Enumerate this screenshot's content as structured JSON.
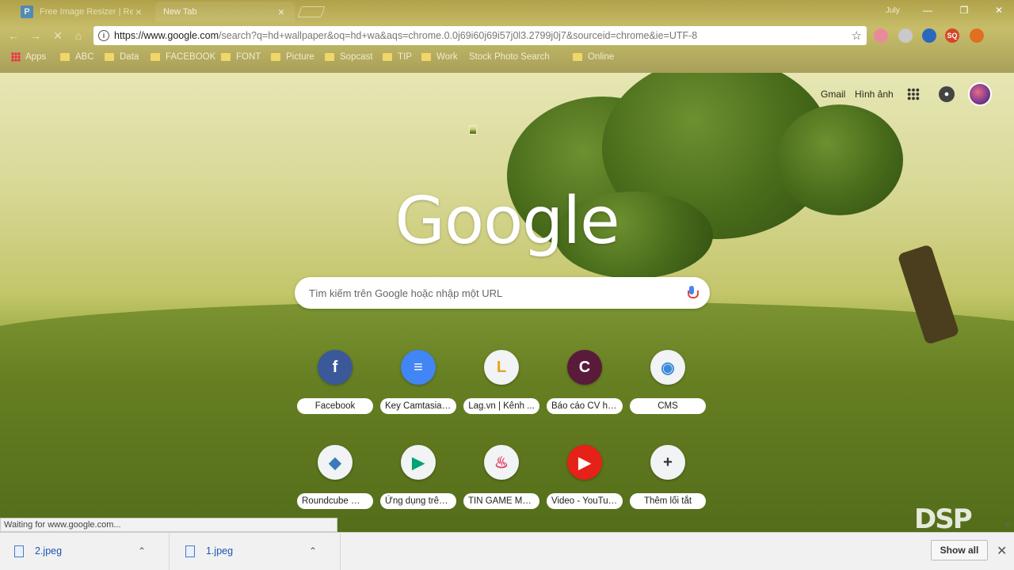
{
  "tabs": [
    {
      "favicon": "P",
      "title": "Free Image Resizer | Res"
    },
    {
      "title": "New Tab"
    }
  ],
  "user_label": "July",
  "window_controls": {
    "minimize": "—",
    "maximize": "❐",
    "close": "✕"
  },
  "omnibox": {
    "host": "https://www.google.com",
    "path": "/search?q=hd+wallpaper&oq=hd+wa&aqs=chrome.0.0j69i60j69i57j0l3.2799j0j7&sourceid=chrome&ie=UTF-8"
  },
  "bookmarks": [
    {
      "label": "Apps",
      "icon": "apps-grid-icon"
    },
    {
      "label": "ABC",
      "icon": "folder-icon"
    },
    {
      "label": "Data",
      "icon": "folder-icon"
    },
    {
      "label": "FACEBOOK",
      "icon": "folder-icon"
    },
    {
      "label": "FONT",
      "icon": "folder-icon"
    },
    {
      "label": "Picture",
      "icon": "folder-icon"
    },
    {
      "label": "Sopcast",
      "icon": "folder-icon"
    },
    {
      "label": "TIP",
      "icon": "folder-icon"
    },
    {
      "label": "Work",
      "icon": "folder-icon"
    },
    {
      "label": "Stock Photo Search",
      "icon": "page-icon"
    },
    {
      "label": "Online",
      "icon": "folder-icon"
    }
  ],
  "extensions": [
    {
      "name": "ext-pig-icon",
      "color": "#e98a9a"
    },
    {
      "name": "ext-circle-icon",
      "color": "#c9c9c9"
    },
    {
      "name": "ext-v-icon",
      "color": "#2a68c0"
    },
    {
      "name": "ext-sq-icon",
      "color": "#d6452a",
      "text": "SQ"
    },
    {
      "name": "ext-fox-icon",
      "color": "#e07020"
    }
  ],
  "google_top": {
    "gmail": "Gmail",
    "images": "Hình ảnh"
  },
  "logo": "Google",
  "search": {
    "placeholder": "Tìm kiếm trên Google hoặc nhập một URL"
  },
  "shortcuts_row1": [
    {
      "label": "Facebook",
      "icon": "facebook-icon",
      "glyph": "f",
      "fg": "#fff",
      "bg": "#3b5998"
    },
    {
      "label": "Key Camtasia 9...",
      "icon": "docs-icon",
      "glyph": "≡",
      "fg": "#fff",
      "bg": "#4285f4"
    },
    {
      "label": "Lag.vn | Kênh ...",
      "icon": "lag-icon",
      "glyph": "L",
      "fg": "#e8a020",
      "bg": "#f1f3f4"
    },
    {
      "label": "Báo cáo CV há...",
      "icon": "letter-c-icon",
      "glyph": "C",
      "fg": "#fff",
      "bg": "#5a1a3a"
    },
    {
      "label": "CMS",
      "icon": "cms-icon",
      "glyph": "◉",
      "fg": "#3a8ad8",
      "bg": "#f1f3f4"
    }
  ],
  "shortcuts_row2": [
    {
      "label": "Roundcube We...",
      "icon": "roundcube-icon",
      "glyph": "◆",
      "fg": "#3a7ab8",
      "bg": "#f1f3f4"
    },
    {
      "label": "Ứng dụng trên ...",
      "icon": "play-store-icon",
      "glyph": "▶",
      "fg": "#00a173",
      "bg": "#f1f3f4"
    },
    {
      "label": "TIN GAME MỚI...",
      "icon": "game-icon",
      "glyph": "♨",
      "fg": "#e04060",
      "bg": "#f1f3f4"
    },
    {
      "label": "Video - YouTube",
      "icon": "youtube-icon",
      "glyph": "▶",
      "fg": "#fff",
      "bg": "#e62117"
    },
    {
      "label": "Thêm lối tắt",
      "icon": "plus-icon",
      "glyph": "+",
      "fg": "#333",
      "bg": "#f1f3f4"
    }
  ],
  "status": "Waiting for www.google.com...",
  "downloads": [
    {
      "name": "2.jpeg"
    },
    {
      "name": "1.jpeg"
    }
  ],
  "show_all": "Show all",
  "watermark": "DSP"
}
